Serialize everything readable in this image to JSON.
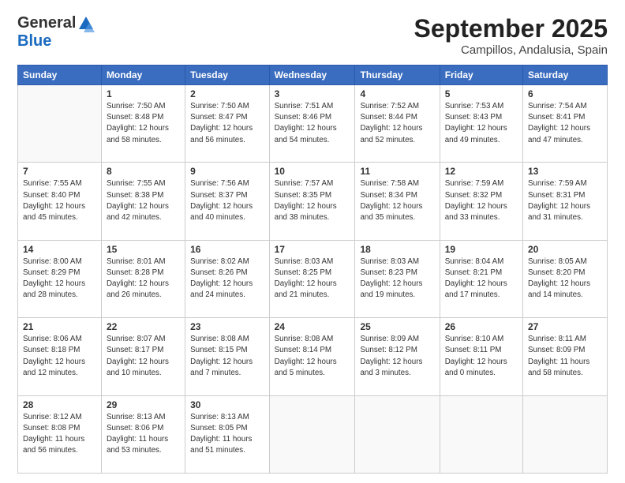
{
  "logo": {
    "general": "General",
    "blue": "Blue"
  },
  "title": "September 2025",
  "location": "Campillos, Andalusia, Spain",
  "headers": [
    "Sunday",
    "Monday",
    "Tuesday",
    "Wednesday",
    "Thursday",
    "Friday",
    "Saturday"
  ],
  "weeks": [
    [
      {
        "day": "",
        "info": ""
      },
      {
        "day": "1",
        "info": "Sunrise: 7:50 AM\nSunset: 8:48 PM\nDaylight: 12 hours\nand 58 minutes."
      },
      {
        "day": "2",
        "info": "Sunrise: 7:50 AM\nSunset: 8:47 PM\nDaylight: 12 hours\nand 56 minutes."
      },
      {
        "day": "3",
        "info": "Sunrise: 7:51 AM\nSunset: 8:46 PM\nDaylight: 12 hours\nand 54 minutes."
      },
      {
        "day": "4",
        "info": "Sunrise: 7:52 AM\nSunset: 8:44 PM\nDaylight: 12 hours\nand 52 minutes."
      },
      {
        "day": "5",
        "info": "Sunrise: 7:53 AM\nSunset: 8:43 PM\nDaylight: 12 hours\nand 49 minutes."
      },
      {
        "day": "6",
        "info": "Sunrise: 7:54 AM\nSunset: 8:41 PM\nDaylight: 12 hours\nand 47 minutes."
      }
    ],
    [
      {
        "day": "7",
        "info": "Sunrise: 7:55 AM\nSunset: 8:40 PM\nDaylight: 12 hours\nand 45 minutes."
      },
      {
        "day": "8",
        "info": "Sunrise: 7:55 AM\nSunset: 8:38 PM\nDaylight: 12 hours\nand 42 minutes."
      },
      {
        "day": "9",
        "info": "Sunrise: 7:56 AM\nSunset: 8:37 PM\nDaylight: 12 hours\nand 40 minutes."
      },
      {
        "day": "10",
        "info": "Sunrise: 7:57 AM\nSunset: 8:35 PM\nDaylight: 12 hours\nand 38 minutes."
      },
      {
        "day": "11",
        "info": "Sunrise: 7:58 AM\nSunset: 8:34 PM\nDaylight: 12 hours\nand 35 minutes."
      },
      {
        "day": "12",
        "info": "Sunrise: 7:59 AM\nSunset: 8:32 PM\nDaylight: 12 hours\nand 33 minutes."
      },
      {
        "day": "13",
        "info": "Sunrise: 7:59 AM\nSunset: 8:31 PM\nDaylight: 12 hours\nand 31 minutes."
      }
    ],
    [
      {
        "day": "14",
        "info": "Sunrise: 8:00 AM\nSunset: 8:29 PM\nDaylight: 12 hours\nand 28 minutes."
      },
      {
        "day": "15",
        "info": "Sunrise: 8:01 AM\nSunset: 8:28 PM\nDaylight: 12 hours\nand 26 minutes."
      },
      {
        "day": "16",
        "info": "Sunrise: 8:02 AM\nSunset: 8:26 PM\nDaylight: 12 hours\nand 24 minutes."
      },
      {
        "day": "17",
        "info": "Sunrise: 8:03 AM\nSunset: 8:25 PM\nDaylight: 12 hours\nand 21 minutes."
      },
      {
        "day": "18",
        "info": "Sunrise: 8:03 AM\nSunset: 8:23 PM\nDaylight: 12 hours\nand 19 minutes."
      },
      {
        "day": "19",
        "info": "Sunrise: 8:04 AM\nSunset: 8:21 PM\nDaylight: 12 hours\nand 17 minutes."
      },
      {
        "day": "20",
        "info": "Sunrise: 8:05 AM\nSunset: 8:20 PM\nDaylight: 12 hours\nand 14 minutes."
      }
    ],
    [
      {
        "day": "21",
        "info": "Sunrise: 8:06 AM\nSunset: 8:18 PM\nDaylight: 12 hours\nand 12 minutes."
      },
      {
        "day": "22",
        "info": "Sunrise: 8:07 AM\nSunset: 8:17 PM\nDaylight: 12 hours\nand 10 minutes."
      },
      {
        "day": "23",
        "info": "Sunrise: 8:08 AM\nSunset: 8:15 PM\nDaylight: 12 hours\nand 7 minutes."
      },
      {
        "day": "24",
        "info": "Sunrise: 8:08 AM\nSunset: 8:14 PM\nDaylight: 12 hours\nand 5 minutes."
      },
      {
        "day": "25",
        "info": "Sunrise: 8:09 AM\nSunset: 8:12 PM\nDaylight: 12 hours\nand 3 minutes."
      },
      {
        "day": "26",
        "info": "Sunrise: 8:10 AM\nSunset: 8:11 PM\nDaylight: 12 hours\nand 0 minutes."
      },
      {
        "day": "27",
        "info": "Sunrise: 8:11 AM\nSunset: 8:09 PM\nDaylight: 11 hours\nand 58 minutes."
      }
    ],
    [
      {
        "day": "28",
        "info": "Sunrise: 8:12 AM\nSunset: 8:08 PM\nDaylight: 11 hours\nand 56 minutes."
      },
      {
        "day": "29",
        "info": "Sunrise: 8:13 AM\nSunset: 8:06 PM\nDaylight: 11 hours\nand 53 minutes."
      },
      {
        "day": "30",
        "info": "Sunrise: 8:13 AM\nSunset: 8:05 PM\nDaylight: 11 hours\nand 51 minutes."
      },
      {
        "day": "",
        "info": ""
      },
      {
        "day": "",
        "info": ""
      },
      {
        "day": "",
        "info": ""
      },
      {
        "day": "",
        "info": ""
      }
    ]
  ]
}
